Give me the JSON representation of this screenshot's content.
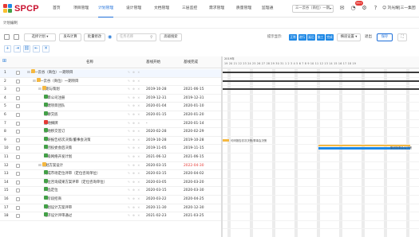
{
  "app": {
    "logo": "SPCP"
  },
  "nav": [
    "首页",
    "项目管理",
    "计划管理",
    "设计管理",
    "文档管理",
    "三层监控",
    "需求管理",
    "质量管理",
    "监理通"
  ],
  "nav_active_index": 2,
  "project_selector": "三一云谷（商位）一期...",
  "notif_badge": "99+",
  "user_name": "刘光耀|三一集团",
  "breadcrumb": "计划编制",
  "toolbar": {
    "plan_select": "选择计划",
    "version_label": "发布计算",
    "batch_edit": "批量修改",
    "search_placeholder": "任务名称",
    "advanced": "高级搜索",
    "status_label": "提示显示:",
    "chips": [
      {
        "label": "正常",
        "color": "#1e88e5"
      },
      {
        "label": "进行",
        "color": "#1e88e5"
      },
      {
        "label": "延后",
        "color": "#1e88e5"
      },
      {
        "label": "施工",
        "color": "#1e88e5"
      },
      {
        "label": "完成",
        "color": "#1e88e5"
      }
    ],
    "gantt_settings": "横道设置",
    "quit": "退出",
    "save": "保存"
  },
  "table": {
    "headers": {
      "name": "名称",
      "start": "基线开始",
      "end": "基线完成"
    },
    "rows": [
      {
        "n": "1",
        "name": "三一云谷（商位）一期项目",
        "start": "",
        "end": "",
        "level": 0,
        "type": "folder"
      },
      {
        "n": "2",
        "name": "三一云谷（商位）一期项目",
        "start": "",
        "end": "",
        "level": 1,
        "type": "folder"
      },
      {
        "n": "3",
        "name": "前期与策划",
        "start": "2019-10-28",
        "end": "2021-06-15",
        "level": 2,
        "type": "folder"
      },
      {
        "n": "4",
        "name": "项目公司注册",
        "start": "2019-12-31",
        "end": "2019-12-31",
        "level": 3,
        "type": "task"
      },
      {
        "n": "5",
        "name": "组建项目团队",
        "start": "2020-01-04",
        "end": "2020-01-10",
        "level": 3,
        "type": "task"
      },
      {
        "n": "6",
        "name": "勘察交底",
        "start": "2020-01-15",
        "end": "2020-01-20",
        "level": 3,
        "type": "task"
      },
      {
        "n": "7",
        "name": "土地摘牌",
        "start": "-",
        "end": "2020-01-14",
        "level": 3,
        "type": "milestone"
      },
      {
        "n": "8",
        "name": "土地移交签订",
        "start": "2020-02-28",
        "end": "2020-02-29",
        "level": 3,
        "type": "task"
      },
      {
        "n": "9",
        "name": "可研报告初次决策/董事会决策",
        "start": "2019-10-28",
        "end": "2019-10-28",
        "level": 3,
        "type": "task"
      },
      {
        "n": "10",
        "name": "集团投委会后决策",
        "start": "2019-11-05",
        "end": "2019-11-15",
        "level": 3,
        "type": "task"
      },
      {
        "n": "11",
        "name": "三级网络开发计划",
        "start": "2021-06-12",
        "end": "2021-06-15",
        "level": 3,
        "type": "task"
      },
      {
        "n": "12",
        "name": "规划方案设计",
        "start": "2020-03-15",
        "end": "2022-04-30",
        "level": 2,
        "type": "folder"
      },
      {
        "n": "13",
        "name": "完成市场定位评审（定位咨询单位）",
        "start": "2020-03-15",
        "end": "2020-04-02",
        "level": 3,
        "type": "task"
      },
      {
        "n": "14",
        "name": "定位咨询成果方案评审（定位咨询单位）",
        "start": "2020-03-05",
        "end": "2020-03-20",
        "level": 3,
        "type": "task"
      },
      {
        "n": "15",
        "name": "产品定位",
        "start": "2020-03-15",
        "end": "2020-03-30",
        "level": 3,
        "type": "task"
      },
      {
        "n": "16",
        "name": "一阶段招商",
        "start": "2020-03-22",
        "end": "2020-04-25",
        "level": 3,
        "type": "task"
      },
      {
        "n": "17",
        "name": "规划设计方案评审",
        "start": "2020-11-30",
        "end": "2020-12-30",
        "level": 3,
        "type": "task"
      },
      {
        "n": "18",
        "name": "经济设计评审通过",
        "start": "2021-02-23",
        "end": "2021-03-25",
        "level": 3,
        "type": "task"
      }
    ]
  },
  "gantt": {
    "year": "2019年",
    "days": "19 20 21 22 23 24 25 26 27 28 29 30 31 1 2 3 4 5 6 7 8 9 10 11 12 13 14 15 16 17 18 19",
    "bar_labels": {
      "row9": "可研报告初次决策/董事会决策",
      "row10": "集团投委会后决策"
    }
  }
}
